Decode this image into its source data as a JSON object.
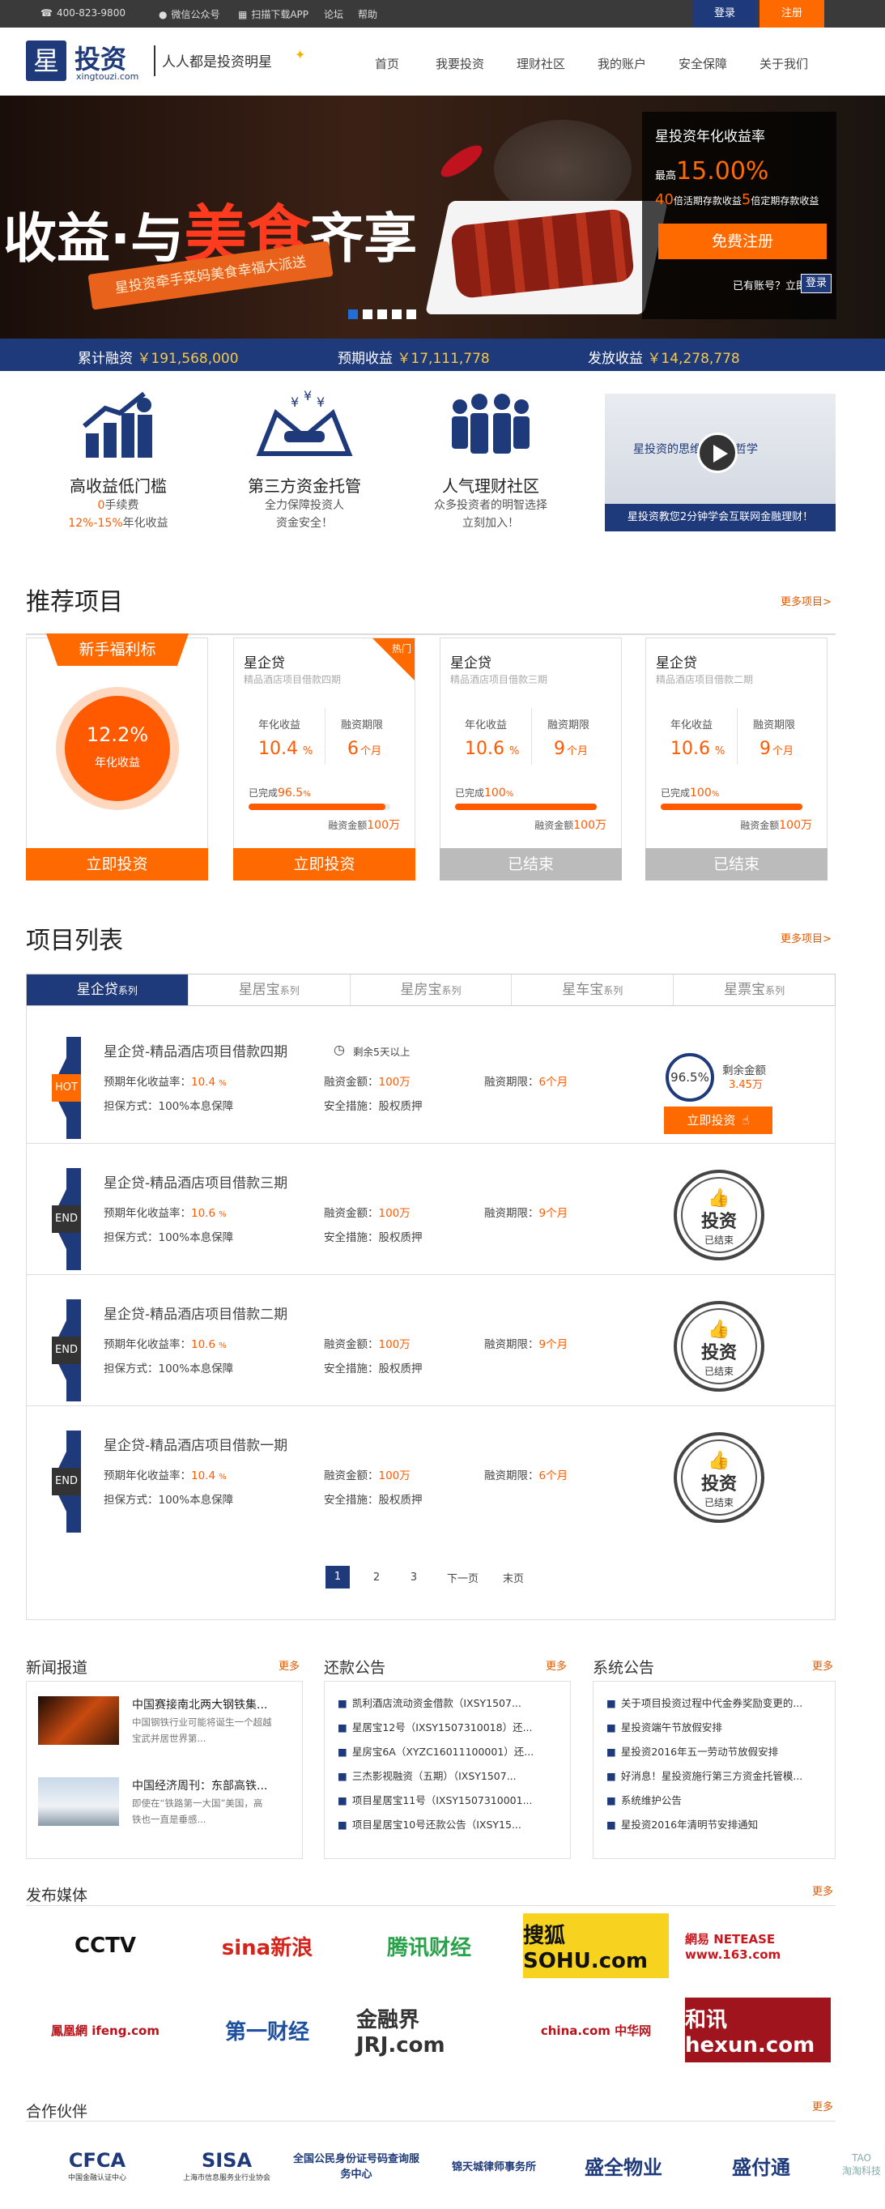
{
  "topbar": {
    "phone": "400-823-9800",
    "wechat": "微信公众号",
    "app": "扫描下载APP",
    "forum": "论坛",
    "help": "帮助",
    "login": "登录",
    "register": "注册"
  },
  "header": {
    "logo_text": "投资",
    "logo_sub": "xingtouzi.com",
    "logo_char": "星",
    "slogan": "人人都是投资明星",
    "nav": [
      "首页",
      "我要投资",
      "理财社区",
      "我的账户",
      "安全保障",
      "关于我们"
    ]
  },
  "banner": {
    "headline_1": "收益·与",
    "headline_hi": "美食",
    "headline_2": "齐享",
    "ribbon": "星投资牵手菜妈美食幸福大派送",
    "panel_title": "星投资年化收益率",
    "rate_prefix": "最高",
    "rate": "15.00%",
    "multi_1": "40",
    "multi_1_text": "倍活期存款收益",
    "multi_2": "5",
    "multi_2_text": "倍定期存款收益",
    "register_btn": "免费注册",
    "has_account": "已有账号？立即",
    "login_btn": "登录"
  },
  "stats": [
    {
      "label": "累计融资",
      "value": "￥191,568,000"
    },
    {
      "label": "预期收益",
      "value": "￥17,111,778"
    },
    {
      "label": "发放收益",
      "value": "￥14,278,778"
    }
  ],
  "features": [
    {
      "title": "高收益低门槛",
      "line1_hi": "0",
      "line1": "手续费",
      "line2_hi": "12%-15%",
      "line2": "年化收益",
      "icon": "chart-up-icon"
    },
    {
      "title": "第三方资金托管",
      "line1": "全力保障投资人",
      "line2": "资金安全！",
      "icon": "handshake-icon"
    },
    {
      "title": "人气理财社区",
      "line1": "众多投资者的明智选择",
      "line2": "立刻加入！",
      "icon": "people-icon"
    }
  ],
  "video": {
    "title": "星投资的思维与投资哲学",
    "caption": "星投资教您2分钟学会互联网金融理财！"
  },
  "recommend": {
    "title": "推荐项目",
    "more": "更多项目>",
    "newbie": {
      "ribbon": "新手福利标",
      "rate": "12.2%",
      "rate_label": "年化收益",
      "button": "立即投资"
    },
    "cards": [
      {
        "name": "星企贷",
        "desc": "精品酒店项目借款四期",
        "badge": "热门",
        "rate": "10.4",
        "rate_unit": "%",
        "rate_label": "年化收益",
        "term": "6",
        "term_unit": "个月",
        "term_label": "融资期限",
        "done_label": "已完成",
        "done": "96.5",
        "progress": 0.965,
        "amount_label": "融资金额",
        "amount": "100万",
        "button": "立即投资",
        "active": true
      },
      {
        "name": "星企贷",
        "desc": "精品酒店项目借款三期",
        "badge": "",
        "rate": "10.6",
        "rate_unit": "%",
        "rate_label": "年化收益",
        "term": "9",
        "term_unit": "个月",
        "term_label": "融资期限",
        "done_label": "已完成",
        "done": "100",
        "progress": 1.0,
        "amount_label": "融资金额",
        "amount": "100万",
        "button": "已结束",
        "active": false
      },
      {
        "name": "星企贷",
        "desc": "精品酒店项目借款二期",
        "badge": "",
        "rate": "10.6",
        "rate_unit": "%",
        "rate_label": "年化收益",
        "term": "9",
        "term_unit": "个月",
        "term_label": "融资期限",
        "done_label": "已完成",
        "done": "100",
        "progress": 1.0,
        "amount_label": "融资金额",
        "amount": "100万",
        "button": "已结束",
        "active": false
      }
    ]
  },
  "list": {
    "title": "项目列表",
    "more": "更多项目>",
    "tabs": [
      {
        "name": "星企贷",
        "suffix": "系列"
      },
      {
        "name": "星居宝",
        "suffix": "系列"
      },
      {
        "name": "星房宝",
        "suffix": "系列"
      },
      {
        "name": "星车宝",
        "suffix": "系列"
      },
      {
        "name": "星票宝",
        "suffix": "系列"
      }
    ],
    "rows": [
      {
        "flag": "HOT",
        "title": "星企贷-精品酒店项目借款四期",
        "remain": "剩余5天以上",
        "rate_label": "预期年化收益率：",
        "rate": "10.4",
        "amount_label": "融资金额：",
        "amount": "100万",
        "term_label": "融资期限：",
        "term": "6个月",
        "guarantee": "担保方式：100%本息保障",
        "safety_label": "安全措施：",
        "safety": "股权质押",
        "percent": "96.5%",
        "left_label": "剩余金额",
        "left": "3.45万",
        "button": "立即投资"
      },
      {
        "flag": "END",
        "title": "星企贷-精品酒店项目借款三期",
        "rate_label": "预期年化收益率：",
        "rate": "10.6",
        "amount_label": "融资金额：",
        "amount": "100万",
        "term_label": "融资期限：",
        "term": "9个月",
        "guarantee": "担保方式：100%本息保障",
        "safety_label": "安全措施：",
        "safety": "股权质押",
        "stamp": "投资",
        "stamp_sub": "已结束"
      },
      {
        "flag": "END",
        "title": "星企贷-精品酒店项目借款二期",
        "rate_label": "预期年化收益率：",
        "rate": "10.6",
        "amount_label": "融资金额：",
        "amount": "100万",
        "term_label": "融资期限：",
        "term": "9个月",
        "guarantee": "担保方式：100%本息保障",
        "safety_label": "安全措施：",
        "safety": "股权质押",
        "stamp": "投资",
        "stamp_sub": "已结束"
      },
      {
        "flag": "END",
        "title": "星企贷-精品酒店项目借款一期",
        "rate_label": "预期年化收益率：",
        "rate": "10.4",
        "amount_label": "融资金额：",
        "amount": "100万",
        "term_label": "融资期限：",
        "term": "6个月",
        "guarantee": "担保方式：100%本息保障",
        "safety_label": "安全措施：",
        "safety": "股权质押",
        "stamp": "投资",
        "stamp_sub": "已结束"
      }
    ],
    "pagination": [
      "1",
      "2",
      "3",
      "下一页",
      "末页"
    ]
  },
  "news": {
    "title": "新闻报道",
    "more": "更多",
    "items": [
      {
        "title": "中国赛接南北两大钢铁集...",
        "desc1": "中国钢铁行业可能将诞生一个超越",
        "desc2": "宝武并居世界第..."
      },
      {
        "title": "中国经济周刊：东部高铁...",
        "desc1": "即使在“铁路第一大国”美国，高",
        "desc2": "铁也一直是垂感..."
      }
    ]
  },
  "repay": {
    "title": "还款公告",
    "more": "更多",
    "items": [
      "凯利酒店流动资金借款（IXSY1507...",
      "星居宝12号（IXSY1507310018）还...",
      "星房宝6A（XYZC16011100001）还...",
      "三杰影视融资（五期）（IXSY1507...",
      "项目星居宝11号（IXSY1507310001...",
      "项目星居宝10号还款公告（IXSY15..."
    ]
  },
  "system": {
    "title": "系统公告",
    "more": "更多",
    "items": [
      "关于项目投资过程中代金券奖励变更的...",
      "星投资端午节放假安排",
      "星投资2016年五一劳动节放假安排",
      "好消息！星投资施行第三方资金托管模...",
      "系统维护公告",
      "星投资2016年清明节安排通知"
    ]
  },
  "media": {
    "title": "发布媒体",
    "more": "更多",
    "logos": [
      {
        "name": "CCTV",
        "color": "#111"
      },
      {
        "name": "sina新浪",
        "color": "#d5241b"
      },
      {
        "name": "腾讯财经",
        "color": "#2aa14b"
      },
      {
        "name": "搜狐 SOHU.com",
        "color": "#111"
      },
      {
        "name": "網易 NETEASE www.163.com",
        "color": "#c8181e"
      },
      {
        "name": "鳳凰網 ifeng.com",
        "color": "#b8121a"
      },
      {
        "name": "第一财经",
        "color": "#1e50a2"
      },
      {
        "name": "金融界 JRJ.com",
        "color": "#333"
      },
      {
        "name": "china.com 中华网",
        "color": "#b8121a"
      },
      {
        "name": "和讯 hexun.com",
        "color": "#fff"
      }
    ]
  },
  "partners": {
    "title": "合作伙伴",
    "more": "更多",
    "logos": [
      {
        "name": "CFCA",
        "sub": "中国金融认证中心"
      },
      {
        "name": "SISA",
        "sub": "上海市信息服务业行业协会"
      },
      {
        "name": "全国公民身份证号码查询服务中心",
        "sub": ""
      },
      {
        "name": "锦天城律师事务所",
        "sub": ""
      },
      {
        "name": "盛全物业",
        "sub": ""
      },
      {
        "name": "盛付通",
        "sub": ""
      }
    ]
  },
  "watermark": {
    "name": "淘淘科技",
    "domain": "TAO"
  }
}
